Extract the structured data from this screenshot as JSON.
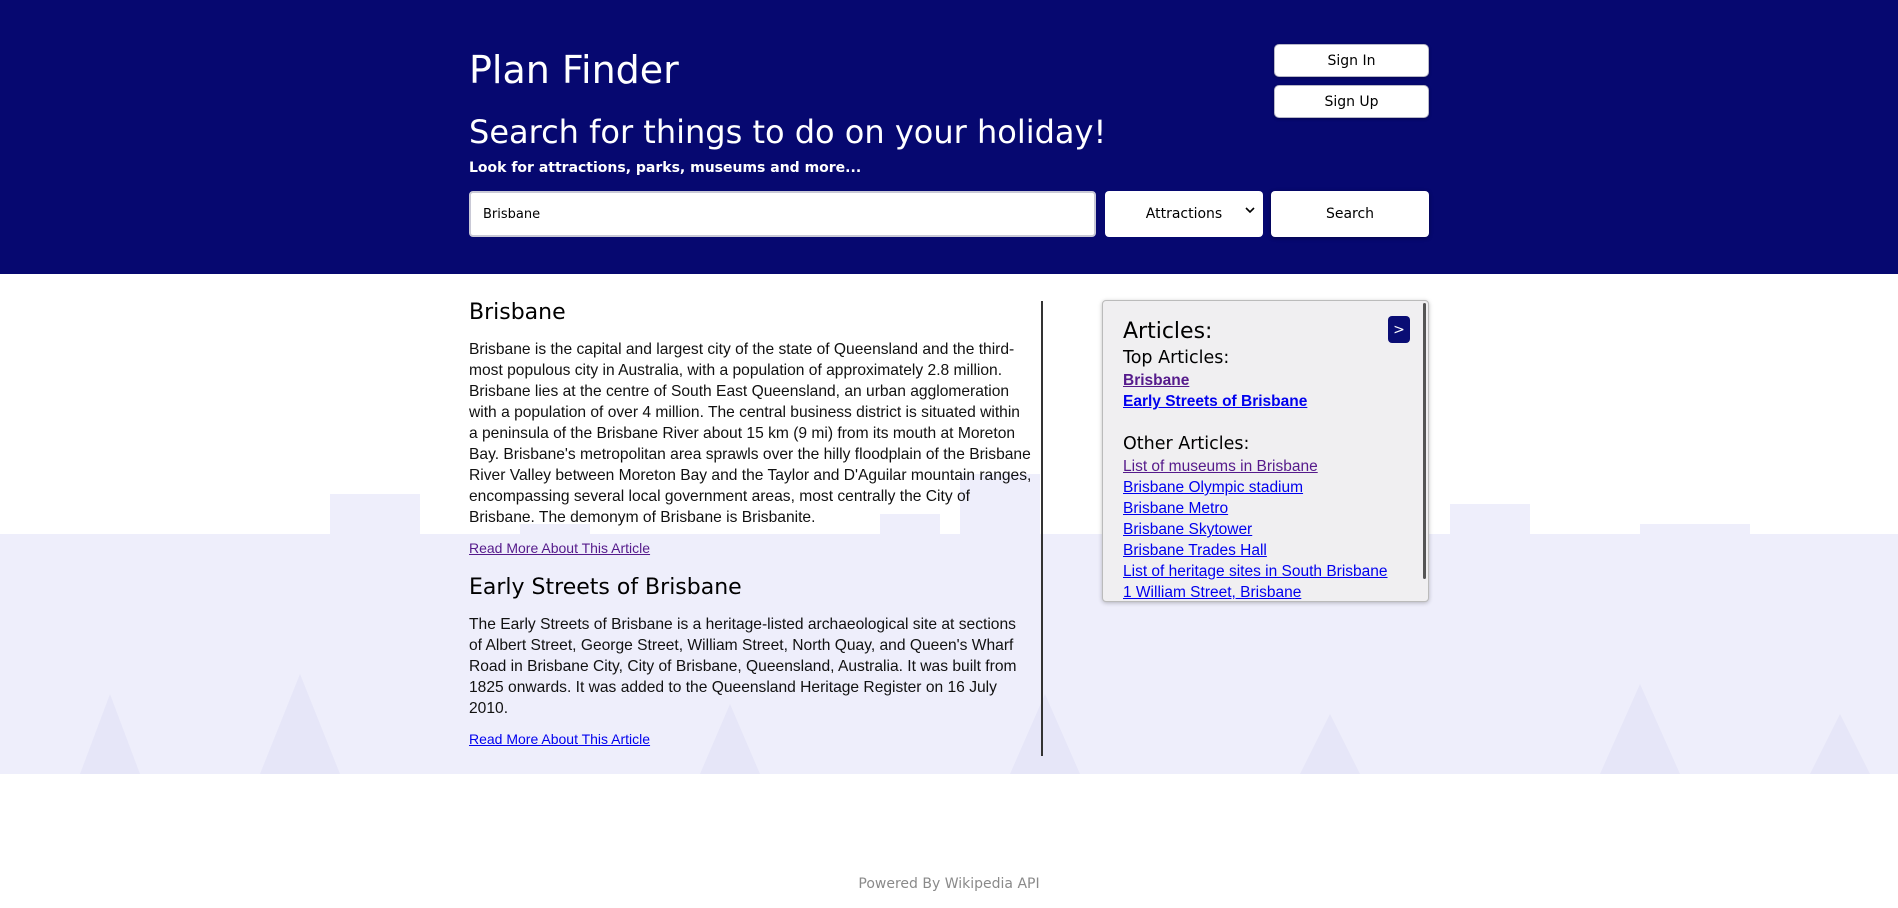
{
  "header": {
    "app_title": "Plan Finder",
    "headline": "Search for things to do on your holiday!",
    "subline": "Look for attractions, parks, museums and more...",
    "sign_in": "Sign In",
    "sign_up": "Sign Up",
    "bg_color": "#060870"
  },
  "search": {
    "value": "Brisbane",
    "category": "Attractions",
    "button_label": "Search"
  },
  "articles": [
    {
      "title": "Brisbane",
      "body": "Brisbane is the capital and largest city of the state of Queensland and the third-most populous city in Australia, with a population of approximately 2.8 million. Brisbane lies at the centre of South East Queensland, an urban agglomeration with a population of over 4 million. The central business district is situated within a peninsula of the Brisbane River about 15 km (9 mi) from its mouth at Moreton Bay. Brisbane's metropolitan area sprawls over the hilly floodplain of the Brisbane River Valley between Moreton Bay and the Taylor and D'Aguilar mountain ranges, encompassing several local government areas, most centrally the City of Brisbane. The demonym of Brisbane is Brisbanite.",
      "read_more": "Read More About This Article"
    },
    {
      "title": "Early Streets of Brisbane",
      "body": "The Early Streets of Brisbane is a heritage-listed archaeological site at sections of Albert Street, George Street, William Street, North Quay, and Queen's Wharf Road in Brisbane City, City of Brisbane, Queensland, Australia. It was built from 1825 onwards. It was added to the Queensland Heritage Register on 16 July 2010.",
      "read_more": "Read More About This Article"
    }
  ],
  "panel": {
    "heading": "Articles:",
    "toggle_label": ">",
    "top_heading": "Top Articles:",
    "top_articles": [
      "Brisbane",
      "Early Streets of Brisbane"
    ],
    "other_heading": "Other Articles:",
    "other_articles": [
      "List of museums in Brisbane",
      "Brisbane Olympic stadium",
      "Brisbane Metro",
      "Brisbane Skytower",
      "Brisbane Trades Hall",
      "List of heritage sites in South Brisbane",
      "1 William Street, Brisbane"
    ]
  },
  "footer": {
    "text": "Powered By Wikipedia API"
  }
}
